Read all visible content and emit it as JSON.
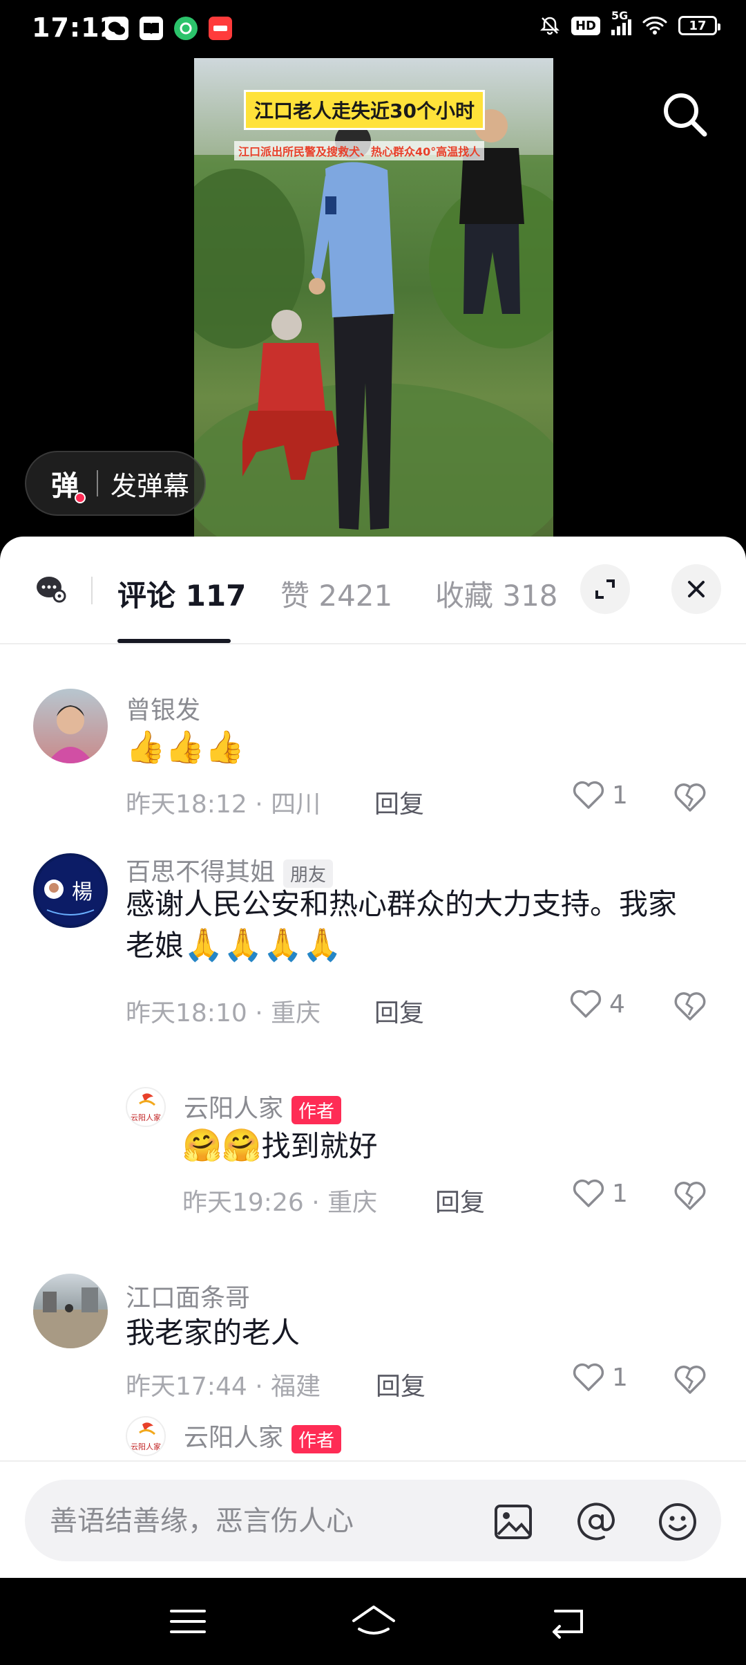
{
  "status_bar": {
    "time": "17:12",
    "network": "5G",
    "hd": "HD",
    "battery": "17",
    "left_icons": [
      "wechat-icon",
      "book-icon",
      "app-green-icon",
      "app-red-icon"
    ]
  },
  "video": {
    "caption": "江口老人走失近30个小时",
    "subcaption": "江口派出所民警及搜救犬、热心群众40°高温找人",
    "danmu_icon": "弹",
    "danmu_label": "发弹幕"
  },
  "sheet": {
    "tabs": [
      {
        "label": "评论 117",
        "active": true
      },
      {
        "label": "赞 2421",
        "active": false
      },
      {
        "label": "收藏 318",
        "active": false
      }
    ]
  },
  "comments": [
    {
      "name": "曾银发",
      "text": "",
      "emojis": [
        "👍",
        "👍",
        "👍"
      ],
      "time": "昨天18:12",
      "location": "四川",
      "reply": "回复",
      "likes": "1"
    },
    {
      "name": "百思不得其姐",
      "badge": "朋友",
      "avatar_text": "楊",
      "text": "感谢人民公安和热心群众的大力支持。我家老娘",
      "emojis": [
        "🙏",
        "🙏",
        "🙏",
        "🙏"
      ],
      "time": "昨天18:10",
      "location": "重庆",
      "reply": "回复",
      "likes": "4"
    },
    {
      "name": "云阳人家",
      "badge": "作者",
      "avatar_text": "云阳人家",
      "text": "找到就好",
      "emojis": [
        "🤗",
        "🤗"
      ],
      "time": "昨天19:26",
      "location": "重庆",
      "reply": "回复",
      "likes": "1"
    },
    {
      "name": "江口面条哥",
      "text": "我老家的老人",
      "time": "昨天17:44",
      "location": "福建",
      "reply": "回复",
      "likes": "1"
    },
    {
      "name": "云阳人家",
      "badge": "作者",
      "avatar_text": "云阳人家"
    }
  ],
  "input": {
    "placeholder": "善语结善缘，恶言伤人心"
  },
  "colors": {
    "accent": "#fe2c55",
    "caption_bg": "#ffe23a"
  }
}
